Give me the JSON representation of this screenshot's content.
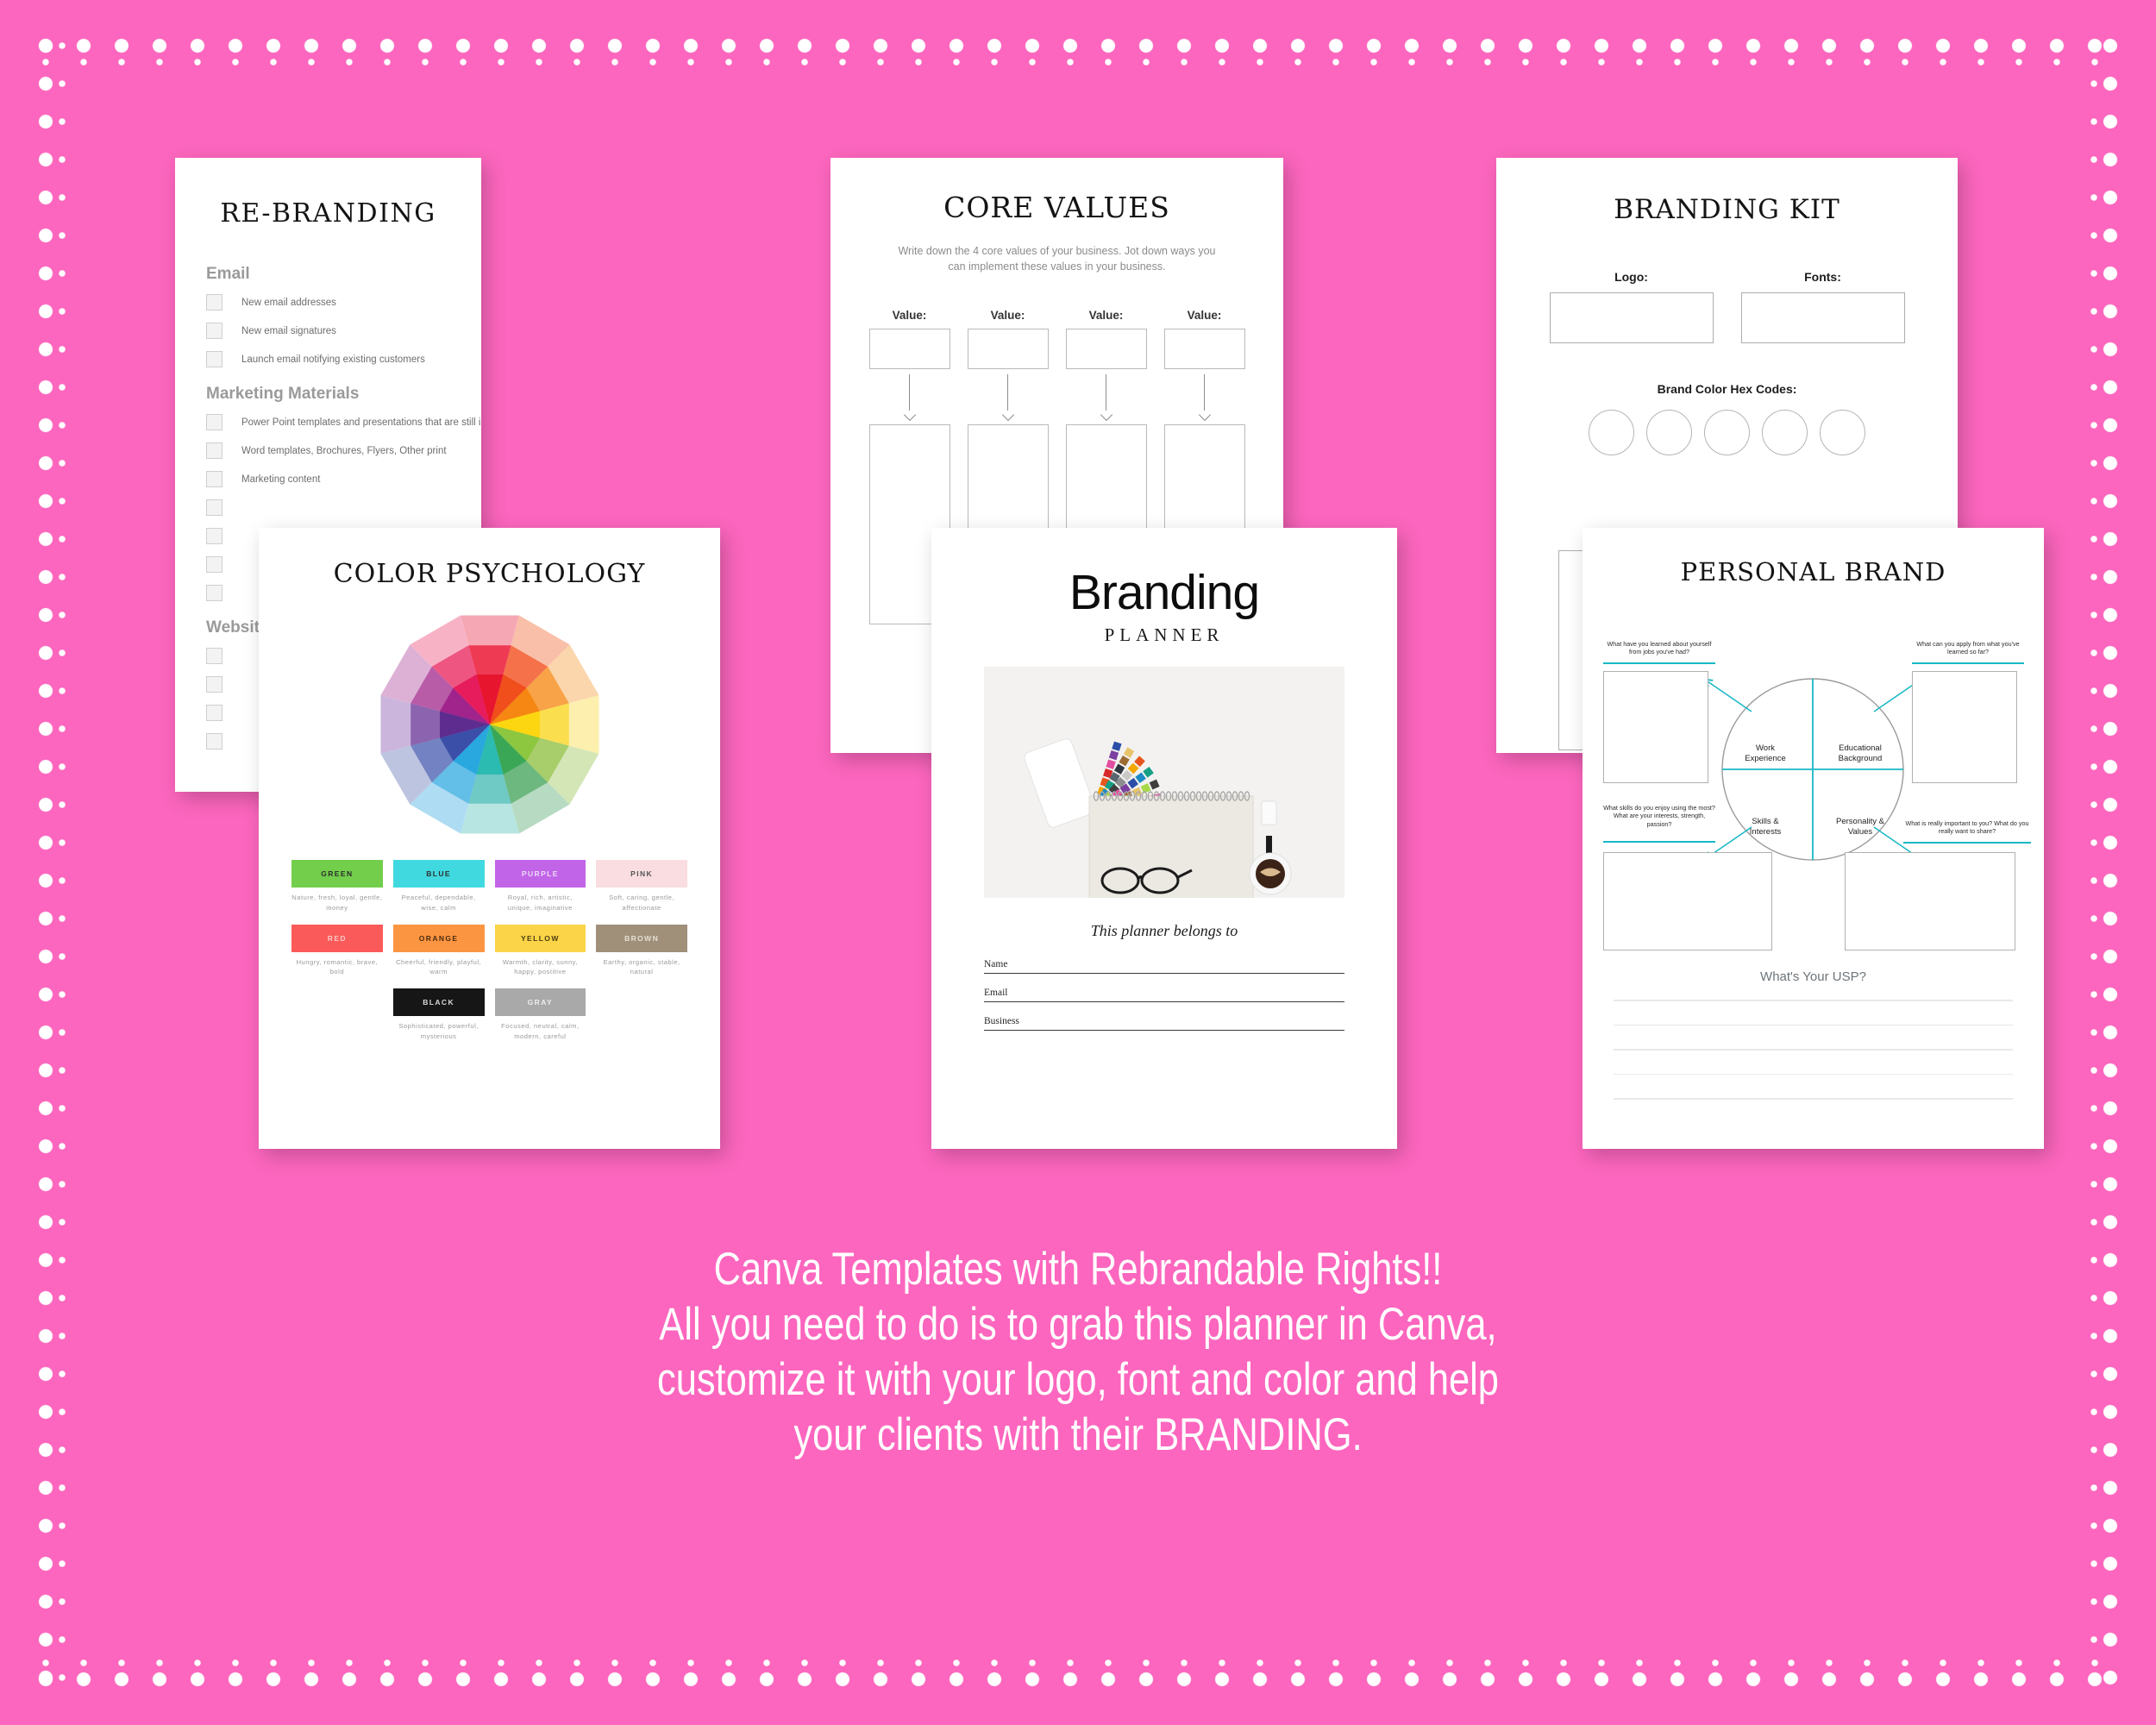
{
  "theme": {
    "background_pink": "#FC66BE",
    "page_white": "#FFFFFF",
    "accent_teal": "#17B8C4"
  },
  "pages": {
    "rebranding": {
      "title": "RE-BRANDING",
      "sections": [
        {
          "heading": "Email",
          "items": [
            "New email addresses",
            "New email  signatures",
            "Launch email notifying existing customers"
          ]
        },
        {
          "heading": "Marketing Materials",
          "items": [
            "Power Point templates and presentations that are still in use",
            "Word templates, Brochures, Flyers, Other print",
            "Marketing content"
          ]
        },
        {
          "heading": "Website",
          "items": [
            "",
            "",
            "",
            ""
          ]
        }
      ],
      "hidden_items": [
        "",
        "",
        "",
        ""
      ]
    },
    "core_values": {
      "title": "CORE VALUES",
      "subtitle": "Write down the 4 core values of your business. Jot down ways you can implement these values in your business.",
      "columns": [
        {
          "label": "Value:",
          "value": "",
          "implementation": ""
        },
        {
          "label": "Value:",
          "value": "",
          "implementation": ""
        },
        {
          "label": "Value:",
          "value": "",
          "implementation": ""
        },
        {
          "label": "Value:",
          "value": "",
          "implementation": ""
        }
      ]
    },
    "branding_kit": {
      "title": "BRANDING KIT",
      "logo_label": "Logo:",
      "fonts_label": "Fonts:",
      "hex_label": "Brand Color Hex Codes:",
      "swatch_count": 5
    },
    "color_psychology": {
      "title": "COLOR PSYCHOLOGY",
      "wheel": {
        "segments": 12,
        "rings": 3,
        "inner_colors": [
          "#E8152F",
          "#F04E1B",
          "#F68712",
          "#FCD611",
          "#8DC63F",
          "#3AA757",
          "#2BBBB0",
          "#29A8E0",
          "#3C4FA8",
          "#5E2C8F",
          "#A0248C",
          "#E61C5D"
        ],
        "mid_colors": [
          "#EF3A54",
          "#F4714A",
          "#F8A347",
          "#FBDE4E",
          "#A8CE6B",
          "#6DB87E",
          "#6FC9C4",
          "#63BEE8",
          "#7282C2",
          "#8C63AE",
          "#B95CA8",
          "#EE5581"
        ],
        "outer_colors": [
          "#F6A7B4",
          "#F9BFA9",
          "#FBD6AC",
          "#FDEFAE",
          "#D4E6B6",
          "#B6DBC2",
          "#B7E5E2",
          "#AEDCF2",
          "#BCC4E0",
          "#CBB5DC",
          "#DDB1D5",
          "#F8B2C6"
        ]
      },
      "swatches": [
        {
          "name": "GREEN",
          "hex": "#72CE4B",
          "text": "#2d2d2d",
          "desc": "Nature, fresh, loyal, gentle, money"
        },
        {
          "name": "BLUE",
          "hex": "#41D9E0",
          "text": "#2d2d2d",
          "desc": "Peaceful, dependable, wise, calm"
        },
        {
          "name": "PURPLE",
          "hex": "#C264E8",
          "text": "#eddcf6",
          "desc": "Royal, rich, artistic, unique, imaginative"
        },
        {
          "name": "PINK",
          "hex": "#F9DDE0",
          "text": "#555555",
          "desc": "Soft, caring, gentle, affectionate"
        },
        {
          "name": "RED",
          "hex": "#FB5A5A",
          "text": "#fbc7c7",
          "desc": "Hungry, romantic, brave, bold"
        },
        {
          "name": "ORANGE",
          "hex": "#FC9541",
          "text": "#4a2c10",
          "desc": "Cheerful, friendly, playful, warm"
        },
        {
          "name": "YELLOW",
          "hex": "#FBD448",
          "text": "#4a3d10",
          "desc": "Warmth, clarity, sunny, happy, postitive"
        },
        {
          "name": "BROWN",
          "hex": "#A0907A",
          "text": "#e6dfd5",
          "desc": "Earthy, organic, stable, natural"
        },
        {
          "name": "BLACK",
          "hex": "#161616",
          "text": "#d9d9d9",
          "desc": "Sophisticated, powerful, mysterious"
        },
        {
          "name": "GRAY",
          "hex": "#A9A9A9",
          "text": "#ededed",
          "desc": "Focused, neutral, calm, modern, careful"
        }
      ]
    },
    "planner_cover": {
      "title": "Branding",
      "subtitle": "PLANNER",
      "belongs_to": "This planner belongs to",
      "fields": [
        "Name",
        "Email",
        "Business"
      ],
      "photo_alt": "color-swatch-fan-notebook-pencil-glasses-coffee"
    },
    "personal_brand": {
      "title": "PERSONAL BRAND",
      "circle_quadrants": [
        "Work Experience",
        "Educational Background",
        "Skills & Interests",
        "Personality & Values"
      ],
      "prompts": [
        "What have you learned about yourself from jobs you've had?",
        "What can you apply from what you've learned so far?",
        "What skills do you enjoy using the most?  What are your interests, strength, passion?",
        "What is really important to you? What do you really want to share?"
      ],
      "usp_label": "What's Your USP?",
      "usp_line_count": 5
    }
  },
  "caption": {
    "lines": [
      "Canva Templates with Rebrandable Rights!!",
      "All you need to do is to grab this planner in Canva,",
      "customize it with your logo, font and color and help",
      "your clients with their BRANDING."
    ]
  }
}
